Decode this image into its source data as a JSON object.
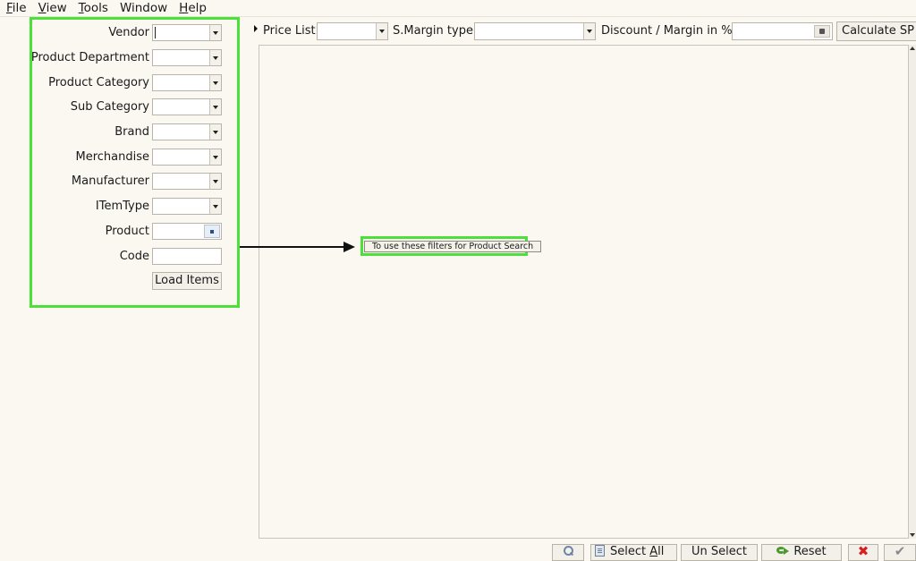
{
  "menubar": {
    "items": [
      {
        "key": "F",
        "rest": "ile"
      },
      {
        "key": "V",
        "rest": "iew"
      },
      {
        "key": "T",
        "rest": "ools"
      },
      {
        "key": "",
        "rest": "Window"
      },
      {
        "key": "H",
        "rest": "elp"
      }
    ]
  },
  "filters": {
    "vendor": {
      "label": "Vendor",
      "value": ""
    },
    "product_department": {
      "label": "Product Department",
      "value": ""
    },
    "product_category": {
      "label": "Product Category",
      "value": ""
    },
    "sub_category": {
      "label": "Sub Category",
      "value": ""
    },
    "brand": {
      "label": "Brand",
      "value": ""
    },
    "merchandise": {
      "label": "Merchandise",
      "value": ""
    },
    "manufacturer": {
      "label": "Manufacturer",
      "value": ""
    },
    "item_type": {
      "label": "ITemType",
      "value": ""
    },
    "product": {
      "label": "Product",
      "value": ""
    },
    "code": {
      "label": "Code",
      "value": ""
    },
    "load_items_label": "Load Items"
  },
  "toolbar": {
    "price_list_label": "Price List",
    "price_list_value": "",
    "margin_type_label": "S.Margin type",
    "margin_type_value": "",
    "discount_label": "Discount / Margin in %",
    "discount_value": "",
    "calculate_label": "Calculate SP"
  },
  "annotation": {
    "text": "To use these filters for Product Search"
  },
  "bottom_bar": {
    "select_all_key": "Select ",
    "select_all_u": "A",
    "select_all_rest": "ll",
    "unselect_label": "Un Select",
    "reset_label": "Reset"
  }
}
